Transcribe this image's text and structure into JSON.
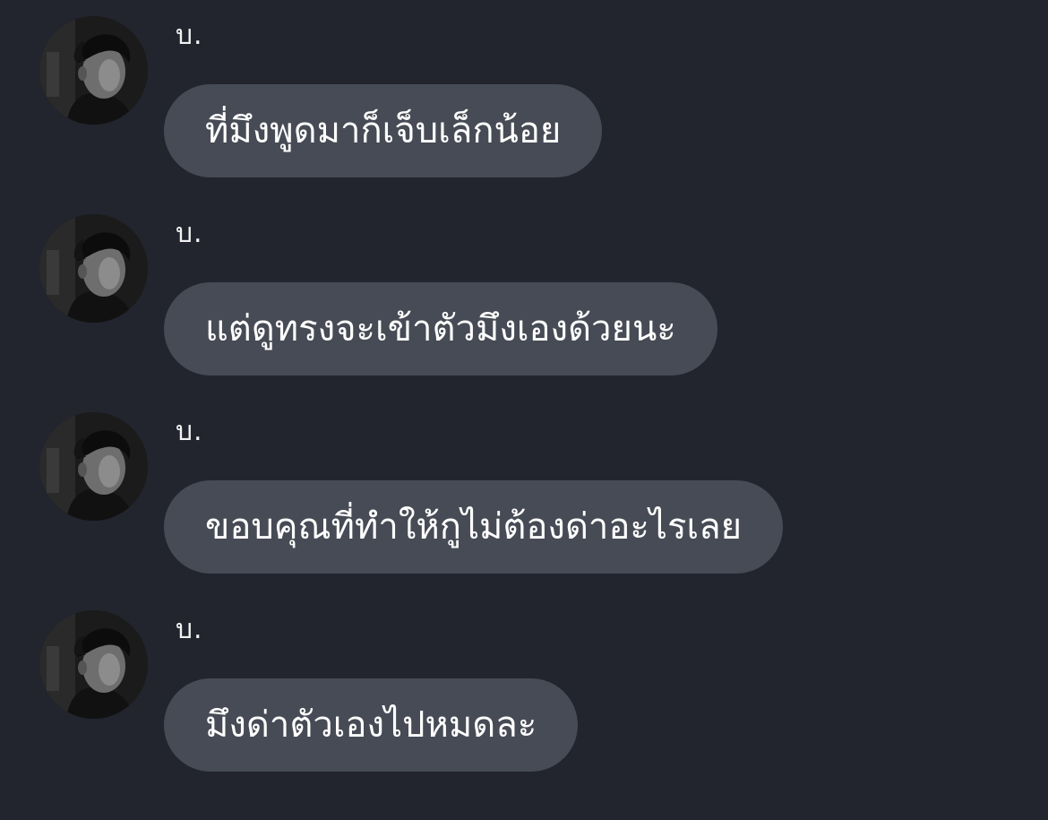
{
  "conversation": {
    "messages": [
      {
        "sender": "บ.",
        "text": "ที่มึงพูดมาก็เจ็บเล็กน้อย",
        "avatar_icon": "profile-photo"
      },
      {
        "sender": "บ.",
        "text": "แต่ดูทรงจะเข้าตัวมึงเองด้วยนะ",
        "avatar_icon": "profile-photo"
      },
      {
        "sender": "บ.",
        "text": "ขอบคุณที่ทำให้กูไม่ต้องด่าอะไรเลย",
        "avatar_icon": "profile-photo"
      },
      {
        "sender": "บ.",
        "text": "มึงด่าตัวเองไปหมดละ",
        "avatar_icon": "profile-photo"
      }
    ]
  },
  "colors": {
    "background": "#22252e",
    "bubble": "#474b55",
    "text": "#ffffff"
  }
}
